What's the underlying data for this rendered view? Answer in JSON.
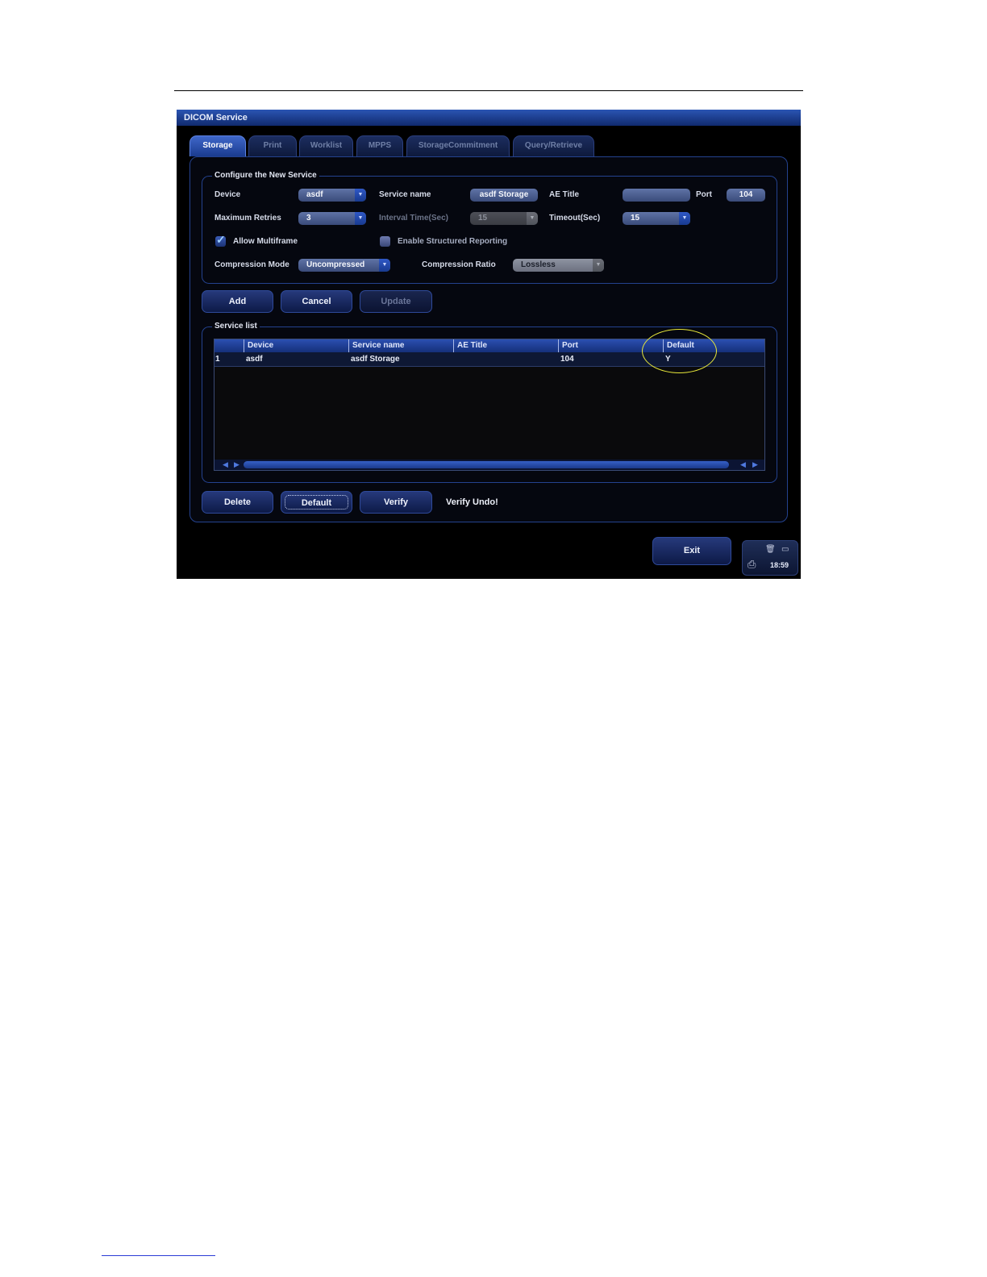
{
  "window": {
    "title": "DICOM Service"
  },
  "tabs": [
    {
      "label": "Storage",
      "active": true
    },
    {
      "label": "Print",
      "active": false
    },
    {
      "label": "Worklist",
      "active": false
    },
    {
      "label": "MPPS",
      "active": false
    },
    {
      "label": "StorageCommitment",
      "active": false
    },
    {
      "label": "Query/Retrieve",
      "active": false
    }
  ],
  "configure": {
    "title": "Configure the New Service",
    "device_label": "Device",
    "device_value": "asdf",
    "service_name_label": "Service name",
    "service_name_value": "asdf Storage",
    "ae_title_label": "AE Title",
    "ae_title_value": "",
    "port_label": "Port",
    "port_value": "104",
    "max_retries_label": "Maximum Retries",
    "max_retries_value": "3",
    "interval_label": "Interval Time(Sec)",
    "interval_value": "15",
    "timeout_label": "Timeout(Sec)",
    "timeout_value": "15",
    "allow_multiframe_label": "Allow Multiframe",
    "allow_multiframe_checked": true,
    "structured_reporting_label": "Enable Structured Reporting",
    "structured_reporting_checked": false,
    "compression_mode_label": "Compression Mode",
    "compression_mode_value": "Uncompressed",
    "compression_ratio_label": "Compression Ratio",
    "compression_ratio_value": "Lossless"
  },
  "buttons": {
    "add": "Add",
    "cancel": "Cancel",
    "update": "Update",
    "delete": "Delete",
    "default": "Default",
    "verify": "Verify",
    "exit": "Exit"
  },
  "service_list": {
    "title": "Service list",
    "columns": [
      "Device",
      "Service name",
      "AE Title",
      "Port",
      "Default"
    ],
    "rows": [
      {
        "index": "1",
        "device": "asdf",
        "service_name": "asdf Storage",
        "ae_title": "",
        "port": "104",
        "default": "Y"
      }
    ]
  },
  "verify_status": "Verify Undo!",
  "tray": {
    "time": "18:59"
  },
  "colors": {
    "accent": "#2b55b3",
    "highlight": "#e8e83a"
  }
}
